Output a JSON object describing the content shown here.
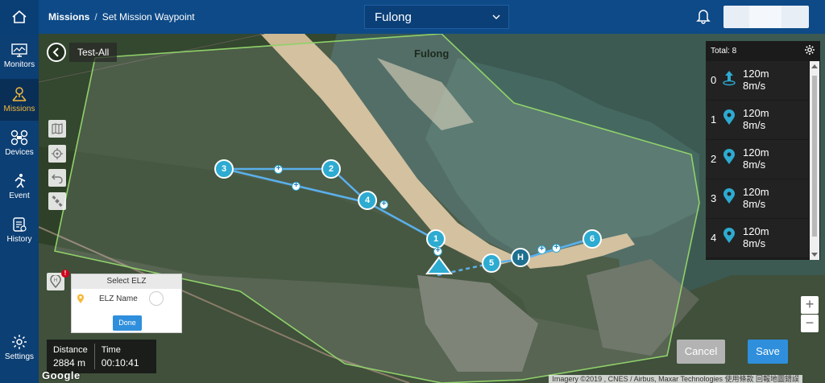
{
  "header": {
    "section": "Missions",
    "page": "Set Mission Waypoint",
    "site": "Fulong"
  },
  "sidebar": {
    "items": [
      {
        "label": "Monitors",
        "icon": "monitor-icon"
      },
      {
        "label": "Missions",
        "icon": "missions-icon",
        "active": true
      },
      {
        "label": "Devices",
        "icon": "drone-icon"
      },
      {
        "label": "Event",
        "icon": "event-icon"
      },
      {
        "label": "History",
        "icon": "history-icon"
      },
      {
        "label": "Settings",
        "icon": "gear-icon"
      }
    ]
  },
  "map": {
    "site_label": "Fulong",
    "google_logo": "Google",
    "attribution": "Imagery ©2019 , CNES / Airbus, Maxar Technologies   使用條款   回報地圖錯誤",
    "mission_name": "Test-All",
    "waypoint_markers": [
      "1",
      "2",
      "3",
      "4",
      "5",
      "6",
      "H"
    ]
  },
  "elz": {
    "title": "Select ELZ",
    "option": "ELZ Name",
    "done": "Done",
    "badge": "!"
  },
  "stats": {
    "distance_label": "Distance",
    "distance_value": "2884 m",
    "time_label": "Time",
    "time_value": "00:10:41"
  },
  "waypoints": {
    "total": "Total: 8",
    "items": [
      {
        "index": "0",
        "altitude": "120m",
        "speed": "8m/s",
        "icon": "takeoff-icon"
      },
      {
        "index": "1",
        "altitude": "120m",
        "speed": "8m/s",
        "icon": "pin-icon"
      },
      {
        "index": "2",
        "altitude": "120m",
        "speed": "8m/s",
        "icon": "pin-icon"
      },
      {
        "index": "3",
        "altitude": "120m",
        "speed": "8m/s",
        "icon": "pin-icon"
      },
      {
        "index": "4",
        "altitude": "120m",
        "speed": "8m/s",
        "icon": "pin-icon"
      }
    ]
  },
  "zoom": {
    "in": "+",
    "out": "−"
  },
  "actions": {
    "cancel": "Cancel",
    "save": "Save"
  },
  "colors": {
    "header": "#0d4a87",
    "active_nav": "#f6b93b",
    "waypoint": "#2dabd1",
    "route": "#5ab0ec",
    "geofence": "#8fd16a",
    "primary_button": "#2f8fdc"
  }
}
